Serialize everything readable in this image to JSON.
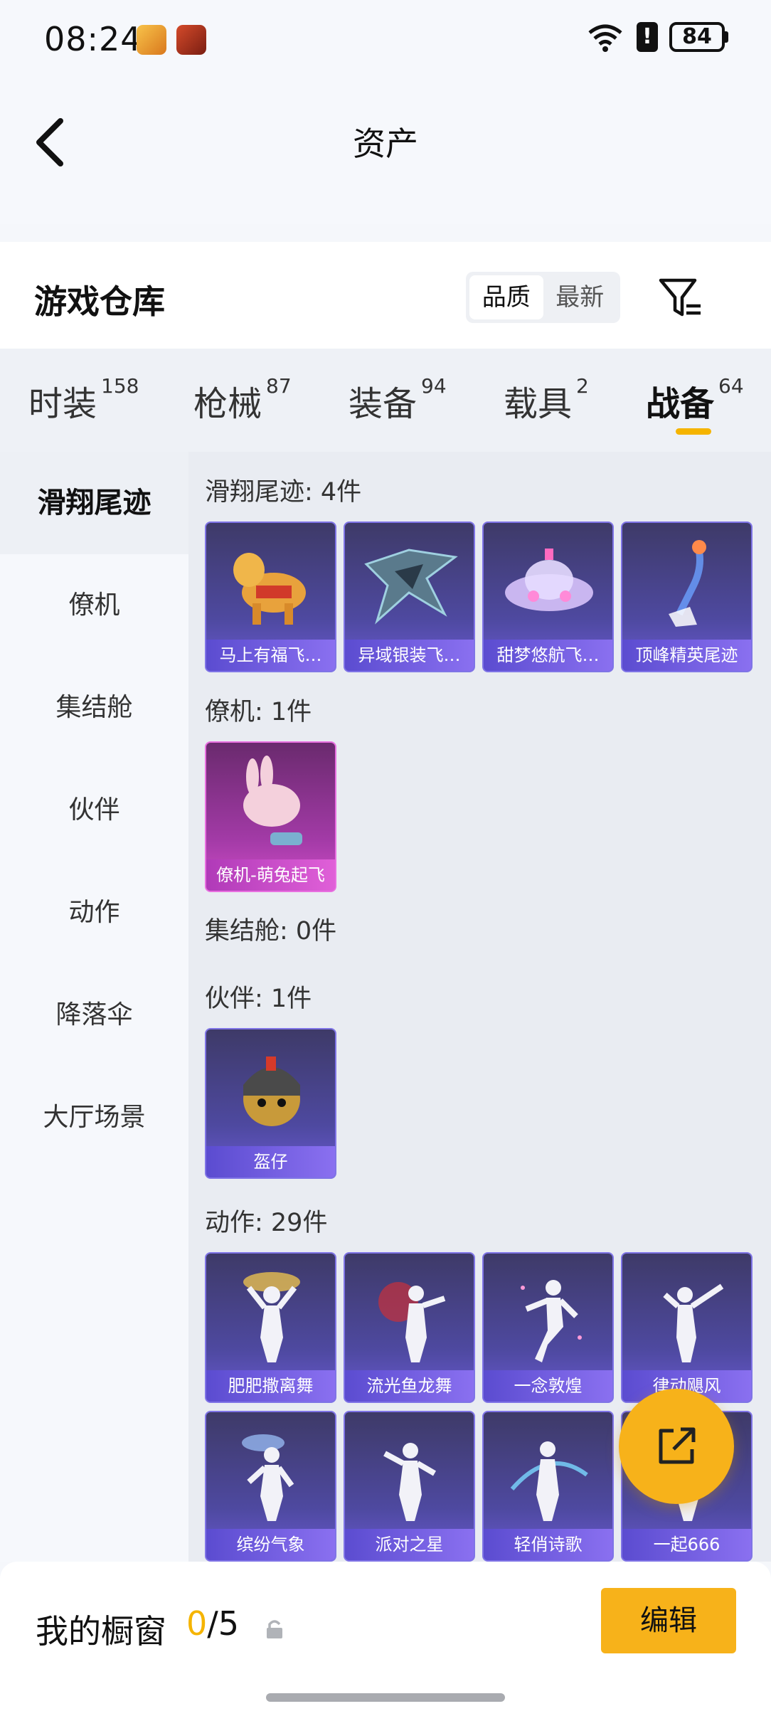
{
  "status_bar": {
    "time": "08:24",
    "battery": "84",
    "alert": "!"
  },
  "header": {
    "title": "资产"
  },
  "warehouse": {
    "title": "游戏仓库",
    "sort_options": [
      "品质",
      "最新"
    ],
    "selected_sort": "品质"
  },
  "tabs": [
    {
      "label": "时装",
      "count": "158"
    },
    {
      "label": "枪械",
      "count": "87"
    },
    {
      "label": "装备",
      "count": "94"
    },
    {
      "label": "载具",
      "count": "2"
    },
    {
      "label": "战备",
      "count": "64",
      "active": true
    }
  ],
  "sidebar": {
    "items": [
      "滑翔尾迹",
      "僚机",
      "集结舱",
      "伙伴",
      "动作",
      "降落伞",
      "大厅场景"
    ],
    "active": "滑翔尾迹"
  },
  "sections": [
    {
      "title": "滑翔尾迹: 4件",
      "items": [
        "马上有福飞…",
        "异域银装飞…",
        "甜梦悠航飞…",
        "顶峰精英尾迹"
      ]
    },
    {
      "title": "僚机: 1件",
      "items": [
        "僚机-萌兔起飞"
      ]
    },
    {
      "title": "集结舱: 0件",
      "items": []
    },
    {
      "title": "伙伴: 1件",
      "items": [
        "盔仔"
      ]
    },
    {
      "title": "动作: 29件",
      "items": [
        "肥肥撒离舞",
        "流光鱼龙舞",
        "一念敦煌",
        "律动飓风",
        "缤纷气象",
        "派对之星",
        "轻俏诗歌",
        "一起666"
      ]
    }
  ],
  "showcase": {
    "title": "我的橱窗",
    "current": "0",
    "separator": "/",
    "max": "5",
    "edit_label": "编辑"
  },
  "colors": {
    "accent": "#f7b21a",
    "card_purple": "#4e49a0",
    "card_pink": "#a23aa6"
  }
}
